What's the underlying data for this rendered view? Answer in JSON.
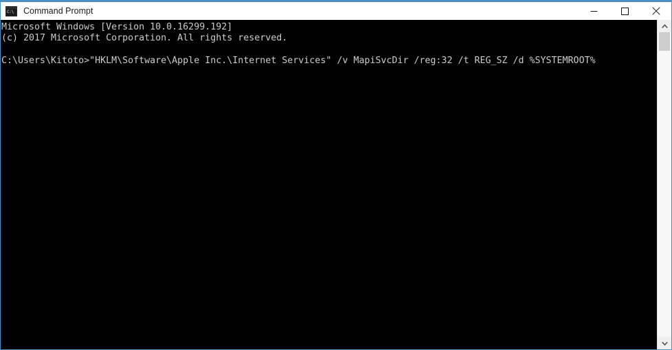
{
  "window": {
    "title": "Command Prompt",
    "icon": "command-prompt-icon",
    "icon_glyph": "C:\\",
    "accent_color": "#4a90c4",
    "titlebar_background": "#ffffff",
    "terminal_background": "#000000",
    "terminal_foreground": "#cccccc"
  },
  "title_buttons": {
    "minimize": "minimize-icon",
    "maximize": "maximize-icon",
    "close": "close-icon"
  },
  "terminal": {
    "lines": [
      "Microsoft Windows [Version 10.0.16299.192]",
      "(c) 2017 Microsoft Corporation. All rights reserved.",
      "",
      "C:\\Users\\Kitoto>\"HKLM\\Software\\Apple Inc.\\Internet Services\" /v MapiSvcDir /reg:32 /t REG_SZ /d %SYSTEMROOT%"
    ],
    "banner_version": "Microsoft Windows [Version 10.0.16299.192]",
    "banner_copyright": "(c) 2017 Microsoft Corporation. All rights reserved.",
    "prompt": "C:\\Users\\Kitoto>",
    "command": "\"HKLM\\Software\\Apple Inc.\\Internet Services\" /v MapiSvcDir /reg:32 /t REG_SZ /d %SYSTEMROOT%"
  },
  "scrollbar": {
    "up_arrow": "chevron-up-icon",
    "down_arrow": "chevron-down-icon",
    "thumb": "scrollbar-thumb"
  }
}
